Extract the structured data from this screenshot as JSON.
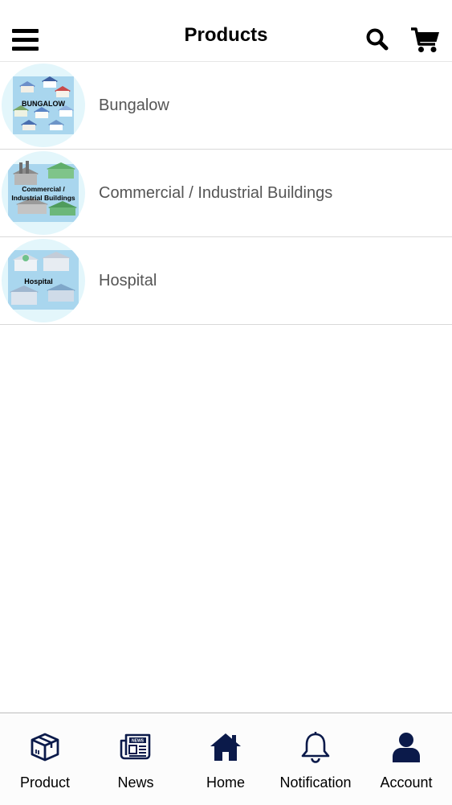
{
  "header": {
    "title": "Products",
    "menu_icon": "hamburger-menu-icon",
    "search_icon": "search-icon",
    "cart_icon": "shopping-cart-icon"
  },
  "products": [
    {
      "label": "Bungalow",
      "thumb_text": "BUNGALOW"
    },
    {
      "label": "Commercial / Industrial Buildings",
      "thumb_text": "Commercial / Industrial Buildings"
    },
    {
      "label": "Hospital",
      "thumb_text": "Hospital"
    }
  ],
  "tabs": [
    {
      "label": "Product",
      "icon": "package-box-icon"
    },
    {
      "label": "News",
      "icon": "newspaper-icon"
    },
    {
      "label": "Home",
      "icon": "home-icon"
    },
    {
      "label": "Notification",
      "icon": "bell-icon"
    },
    {
      "label": "Account",
      "icon": "user-icon"
    }
  ],
  "colors": {
    "icon_dark": "#0b1a4a",
    "row_text": "#555555",
    "thumb_bg": "#e3f6fb"
  }
}
